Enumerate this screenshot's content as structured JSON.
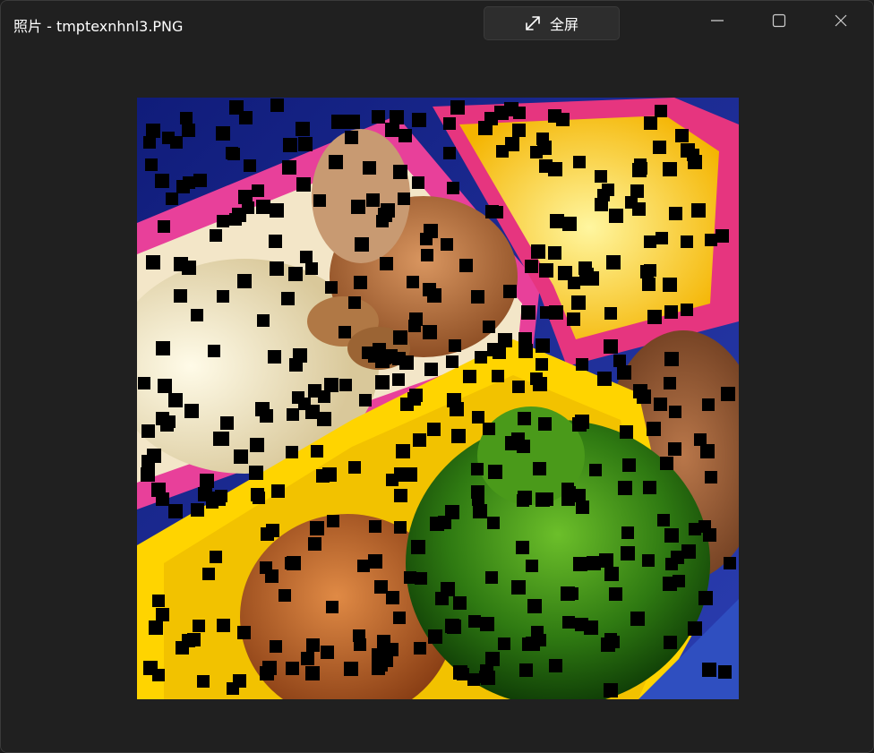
{
  "window": {
    "title": "照片 - tmptexnhnl3.PNG"
  },
  "toolbar": {
    "fullscreen_label": "全屏",
    "fullscreen_icon": "expand-arrows-icon"
  },
  "caption_buttons": {
    "minimize_icon": "minimize-icon",
    "maximize_icon": "maximize-icon",
    "close_icon": "close-icon"
  },
  "photo": {
    "description_icon": "bento-lunch-photo-with-black-square-noise"
  },
  "colors": {
    "window_bg": "#202020",
    "button_bg": "#2d2d2d",
    "text": "#ffffff"
  }
}
